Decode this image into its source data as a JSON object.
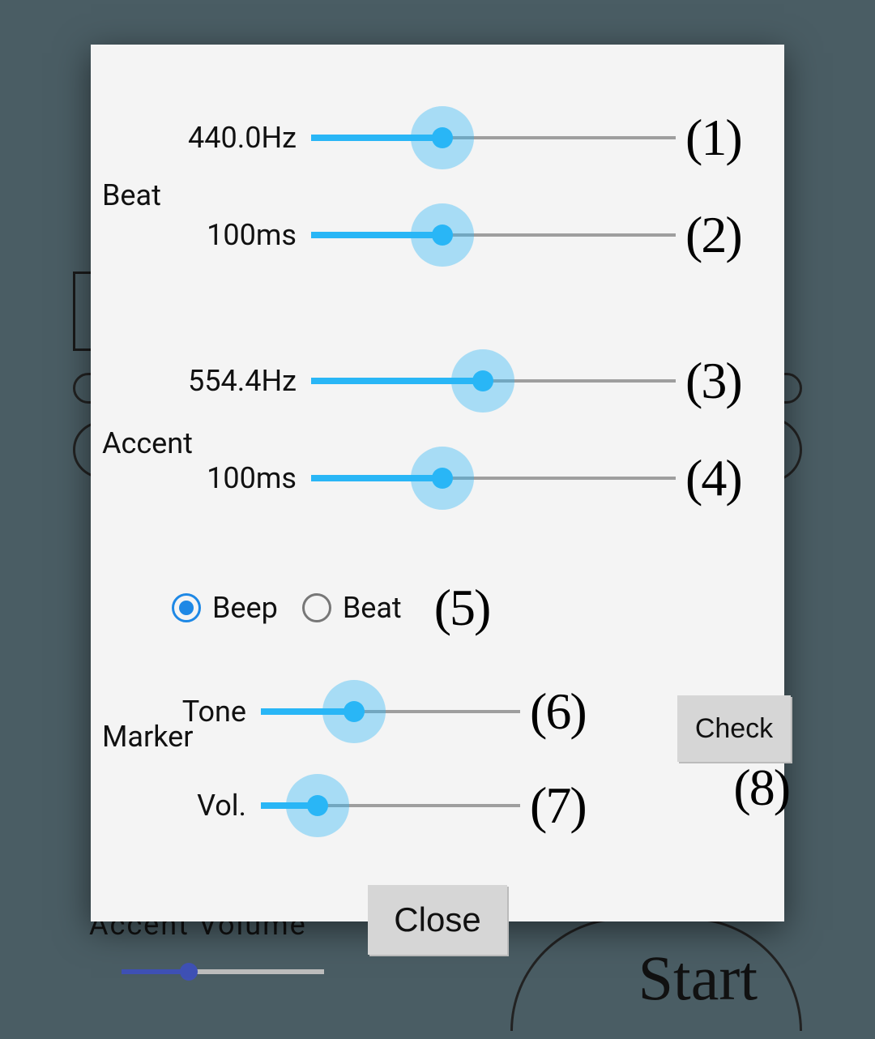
{
  "beat": {
    "label": "Beat",
    "freq": {
      "value": "440.0Hz",
      "percent": 36,
      "annot": "(1)"
    },
    "dur": {
      "value": "100ms",
      "percent": 36,
      "annot": "(2)"
    }
  },
  "accent": {
    "label": "Accent",
    "freq": {
      "value": "554.4Hz",
      "percent": 47,
      "annot": "(3)"
    },
    "dur": {
      "value": "100ms",
      "percent": 36,
      "annot": "(4)"
    }
  },
  "marker": {
    "label": "Marker",
    "radio": {
      "beep": "Beep",
      "beat": "Beat",
      "selected": "beep",
      "annot": "(5)"
    },
    "tone": {
      "value": "Tone",
      "percent": 36,
      "annot": "(6)"
    },
    "vol": {
      "value": "Vol.",
      "percent": 22,
      "annot": "(7)"
    },
    "check_label": "Check",
    "check_annot": "(8)"
  },
  "close_label": "Close",
  "bg": {
    "start": "Start",
    "accent_volume": "Accent Volume"
  }
}
